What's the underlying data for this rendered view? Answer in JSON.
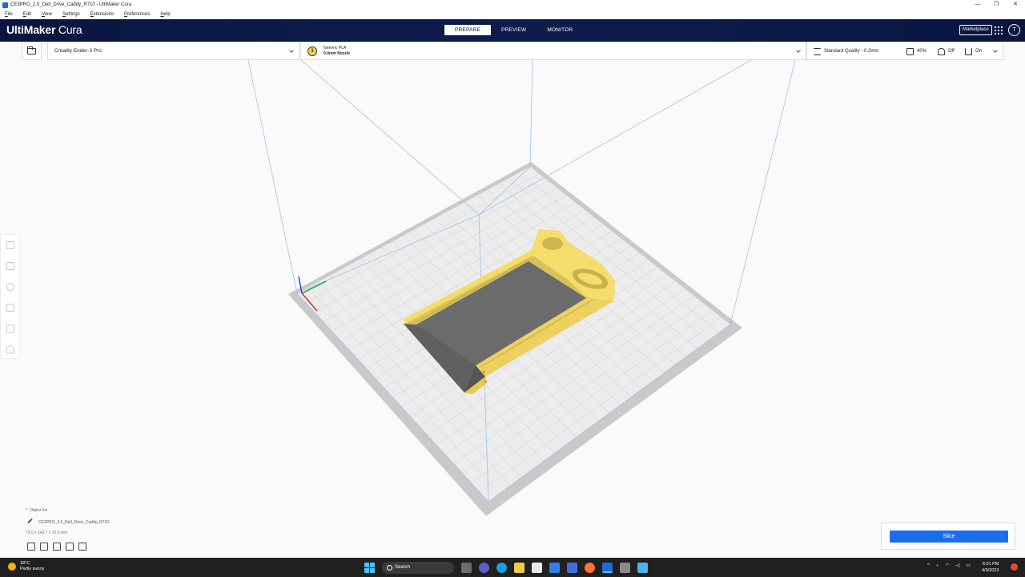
{
  "window": {
    "title": "CE3PRO_2.5_Dell_Drive_Caddy_R710 - UltiMaker Cura",
    "controls": [
      "—",
      "❐",
      "✕"
    ]
  },
  "menu": [
    "File",
    "Edit",
    "View",
    "Settings",
    "Extensions",
    "Preferences",
    "Help"
  ],
  "header": {
    "logo_bold": "UltiMaker",
    "logo_light": " Cura",
    "tabs": [
      "PREPARE",
      "PREVIEW",
      "MONITOR"
    ],
    "active_tab": "PREPARE",
    "marketplace_label": "Marketplace",
    "account_initial": "T"
  },
  "toolbar": {
    "printer": "Creality Ender-3 Pro",
    "material_line1": "Generic PLA",
    "material_line2": "0.4mm Nozzle",
    "nozzle_badge": "1",
    "quality": "Standard Quality - 0.2mm",
    "infill": "40%",
    "support": "Off",
    "adhesion": "On"
  },
  "object_list": {
    "header": "Object list",
    "object_name": "CE3PRO_2.5_Dell_Drive_Caddy_R710",
    "dimensions": "79.0 x 140.7 x 15.0 mm"
  },
  "slice": {
    "button_label": "Slice"
  },
  "taskbar": {
    "temperature": "18°C",
    "weather": "Partly sunny",
    "search_label": "Search",
    "time": "6:31 PM",
    "date": "4/9/2023"
  },
  "colors": {
    "header_bg": "#0d1c4b",
    "accent": "#196ef0",
    "model_yellow": "#f6dc6a",
    "build_plate": "#d4d4d4"
  }
}
